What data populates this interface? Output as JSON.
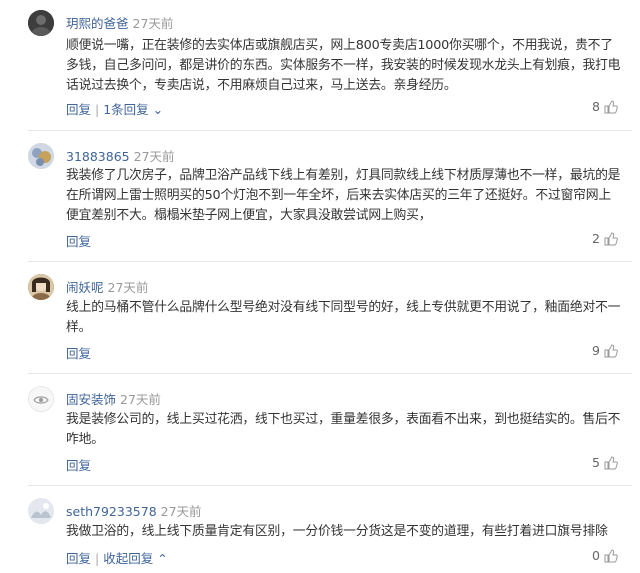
{
  "comments": [
    {
      "username": "玥熙的爸爸",
      "time": "27天前",
      "text": "顺便说一嘴，正在装修的去实体店或旗舰店买，网上800专卖店1000你买哪个，不用我说，贵不了多钱，自己多问问，都是讲价的东西。实体服务不一样，我安装的时候发现水龙头上有划痕，我打电话说过去换个，专卖店说，不用麻烦自己过来，马上送去。亲身经历。",
      "reply_label": "回复",
      "reply_count_label": "1条回复",
      "likes": "8",
      "avatar_color": "#555555"
    },
    {
      "username": "31883865",
      "time": "27天前",
      "text": "我装修了几次房子，品牌卫浴产品线下线上有差别，灯具同款线上线下材质厚薄也不一样，最坑的是在所谓网上雷士照明买的50个灯泡不到一年全坏，后来去实体店买的三年了还挺好。不过窗帘网上便宜差别不大。榻榻米垫子网上便宜，大家具没敢尝试网上购买，",
      "reply_label": "回复",
      "likes": "2",
      "avatar_color": "#8a9bb3"
    },
    {
      "username": "闹妖呢",
      "time": "27天前",
      "text": "线上的马桶不管什么品牌什么型号绝对没有线下同型号的好，线上专供就更不用说了，釉面绝对不一样。",
      "reply_label": "回复",
      "likes": "9",
      "avatar_color": "#7a5a3c"
    },
    {
      "username": "固安装饰",
      "time": "27天前",
      "text": "我是装修公司的，线上买过花洒，线下也买过，重量差很多，表面看不出来，到也挺结实的。售后不咋地。",
      "reply_label": "回复",
      "likes": "5",
      "avatar_color": "#e8e8e8"
    },
    {
      "username": "seth79233578",
      "time": "27天前",
      "text": "我做卫浴的，线上线下质量肯定有区别，一分价钱一分货这是不变的道理，有些打着进口旗号排除",
      "reply_label": "回复",
      "collapse_label": "收起回复",
      "likes": "0",
      "avatar_color": "#dfe4ea"
    }
  ],
  "colors": {
    "username": "#406599",
    "time": "#999999",
    "text": "#333333",
    "divider": "#e6e6e6"
  }
}
